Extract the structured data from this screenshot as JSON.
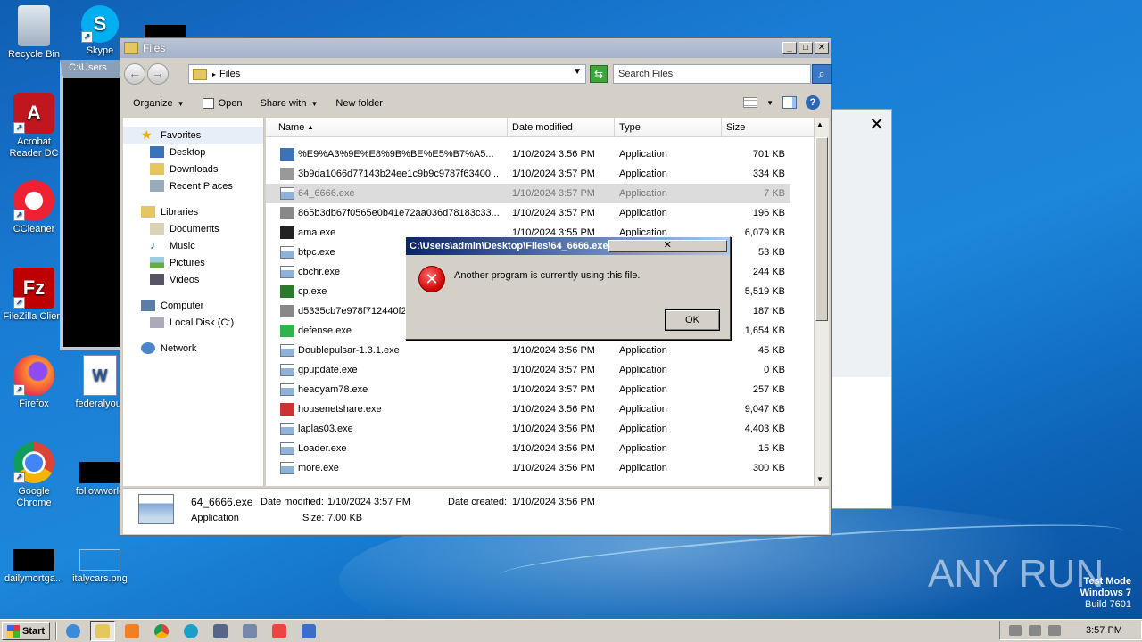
{
  "desktop": {
    "icons": [
      {
        "label": "Recycle Bin"
      },
      {
        "label": "Skype"
      },
      {
        "label": "Acrobat Reader DC"
      },
      {
        "label": "CCleaner"
      },
      {
        "label": "FileZilla Client"
      },
      {
        "label": "Firefox"
      },
      {
        "label": "federalyour"
      },
      {
        "label": "Google Chrome"
      },
      {
        "label": "followworld"
      },
      {
        "label": "dailymortga..."
      },
      {
        "label": "italycars.png"
      }
    ],
    "console_title": "C:\\Users"
  },
  "explorer": {
    "title": "Files",
    "address": "Files",
    "search_placeholder": "Search Files",
    "toolbar": {
      "organize": "Organize",
      "open": "Open",
      "share_with": "Share with",
      "new_folder": "New folder"
    },
    "nav": {
      "favorites": "Favorites",
      "desktop": "Desktop",
      "downloads": "Downloads",
      "recent_places": "Recent Places",
      "libraries": "Libraries",
      "documents": "Documents",
      "music": "Music",
      "pictures": "Pictures",
      "videos": "Videos",
      "computer": "Computer",
      "local_disk": "Local Disk (C:)",
      "network": "Network"
    },
    "columns": {
      "name": "Name",
      "date": "Date modified",
      "type": "Type",
      "size": "Size"
    },
    "files": [
      {
        "name": "%E9%A3%9E%E8%9B%BE%E5%B7%A5...",
        "date": "1/10/2024 3:56 PM",
        "type": "Application",
        "size": "701 KB"
      },
      {
        "name": "3b9da1066d77143b24ee1c9b9c9787f63400...",
        "date": "1/10/2024 3:57 PM",
        "type": "Application",
        "size": "334 KB"
      },
      {
        "name": "64_6666.exe",
        "date": "1/10/2024 3:57 PM",
        "type": "Application",
        "size": "7 KB"
      },
      {
        "name": "865b3db67f0565e0b41e72aa036d78183c33...",
        "date": "1/10/2024 3:57 PM",
        "type": "Application",
        "size": "196 KB"
      },
      {
        "name": "ama.exe",
        "date": "1/10/2024 3:55 PM",
        "type": "Application",
        "size": "6,079 KB"
      },
      {
        "name": "btpc.exe",
        "date": "",
        "type": "",
        "size": "53 KB"
      },
      {
        "name": "cbchr.exe",
        "date": "",
        "type": "",
        "size": "244 KB"
      },
      {
        "name": "cp.exe",
        "date": "",
        "type": "",
        "size": "5,519 KB"
      },
      {
        "name": "d5335cb7e978f712440f2",
        "date": "",
        "type": "",
        "size": "187 KB"
      },
      {
        "name": "defense.exe",
        "date": "",
        "type": "",
        "size": "1,654 KB"
      },
      {
        "name": "Doublepulsar-1.3.1.exe",
        "date": "1/10/2024 3:56 PM",
        "type": "Application",
        "size": "45 KB"
      },
      {
        "name": "gpupdate.exe",
        "date": "1/10/2024 3:57 PM",
        "type": "Application",
        "size": "0 KB"
      },
      {
        "name": "heaoyam78.exe",
        "date": "1/10/2024 3:57 PM",
        "type": "Application",
        "size": "257 KB"
      },
      {
        "name": "housenetshare.exe",
        "date": "1/10/2024 3:56 PM",
        "type": "Application",
        "size": "9,047 KB"
      },
      {
        "name": "laplas03.exe",
        "date": "1/10/2024 3:56 PM",
        "type": "Application",
        "size": "4,403 KB"
      },
      {
        "name": "Loader.exe",
        "date": "1/10/2024 3:56 PM",
        "type": "Application",
        "size": "15 KB"
      },
      {
        "name": "more.exe",
        "date": "1/10/2024 3:56 PM",
        "type": "Application",
        "size": "300 KB"
      }
    ],
    "details": {
      "name": "64_6666.exe",
      "type": "Application",
      "modified_label": "Date modified:",
      "modified_value": "1/10/2024 3:57 PM",
      "size_label": "Size:",
      "size_value": "7.00 KB",
      "created_label": "Date created:",
      "created_value": "1/10/2024 3:56 PM"
    }
  },
  "dialog": {
    "title": "C:\\Users\\admin\\Desktop\\Files\\64_6666.exe",
    "message": "Another program is currently using this file.",
    "ok": "OK"
  },
  "taskbar": {
    "start": "Start",
    "clock": "3:57 PM"
  },
  "watermark": {
    "line1": "Test Mode",
    "line2": "Windows 7",
    "line3": "Build 7601",
    "brand": "ANY RUN"
  },
  "colors": {
    "accent": "#0a246a",
    "error": "#cc0000",
    "selection": "#dcdcdc"
  }
}
